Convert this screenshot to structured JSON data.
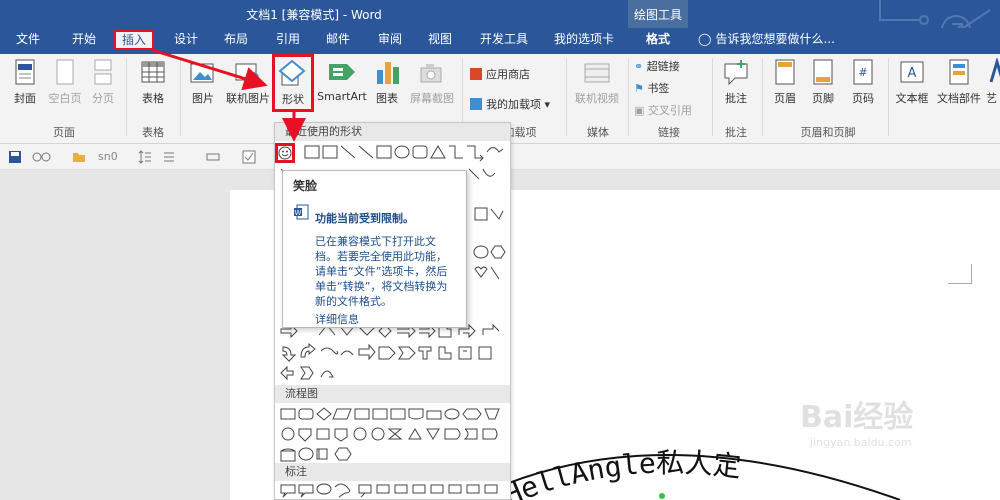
{
  "title_bar": {
    "doc_title": "文档1 [兼容模式] - Word",
    "context_group": "绘图工具"
  },
  "tabs": [
    {
      "label": "文件"
    },
    {
      "label": "开始"
    },
    {
      "label": "插入",
      "active": true,
      "highlighted": true
    },
    {
      "label": "设计"
    },
    {
      "label": "布局"
    },
    {
      "label": "引用"
    },
    {
      "label": "邮件"
    },
    {
      "label": "审阅"
    },
    {
      "label": "视图"
    },
    {
      "label": "开发工具"
    },
    {
      "label": "我的选项卡"
    },
    {
      "label": "格式",
      "contextual": true
    }
  ],
  "tell_me": "告诉我您想要做什么...",
  "ribbon": {
    "pages": {
      "cover": "封面",
      "blank": "空白页",
      "break": "分页",
      "group": "页面"
    },
    "tables": {
      "table": "表格",
      "group": "表格"
    },
    "illustrations": {
      "picture": "图片",
      "online_picture": "联机图片",
      "shapes": "形状",
      "smartart": "SmartArt",
      "chart": "图表",
      "screenshot": "屏幕截图"
    },
    "addins": {
      "store": "应用商店",
      "my_addins": "我的加载项",
      "group": "加载项"
    },
    "media": {
      "online_video": "联机视频",
      "group": "媒体"
    },
    "links": {
      "hyperlink": "超链接",
      "bookmark": "书签",
      "cross_ref": "交叉引用",
      "group": "链接"
    },
    "comments": {
      "comment": "批注",
      "group": "批注"
    },
    "header_footer": {
      "header": "页眉",
      "footer": "页脚",
      "page_number": "页码",
      "group": "页眉和页脚"
    },
    "text": {
      "textbox": "文本框",
      "quick_parts": "文档部件",
      "wordart": "艺"
    }
  },
  "qat": {
    "style": "sn0"
  },
  "gallery": {
    "recent_header": "最近使用的形状",
    "flowchart_header": "流程图",
    "callouts_header": "标注"
  },
  "tooltip": {
    "title": "笑脸",
    "heading": "功能当前受到限制。",
    "body": "已在兼容模式下打开此文档。若要完全使用此功能，请单击“文件”选项卡，然后单击“转换”，将文档转换为新的文件格式。",
    "link": "详细信息"
  },
  "document": {
    "arc_text": "HellAngle私人定"
  },
  "watermark": {
    "text": "Bai经验",
    "url": "jingyan.baidu.com"
  },
  "colors": {
    "ribbon_blue": "#2b579a",
    "annotation_red": "#e81123",
    "tooltip_blue": "#1e4e8c"
  }
}
